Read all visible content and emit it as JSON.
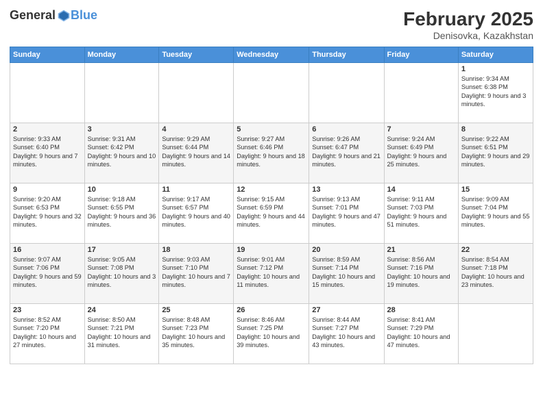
{
  "header": {
    "logo_general": "General",
    "logo_blue": "Blue",
    "title": "February 2025",
    "subtitle": "Denisovka, Kazakhstan"
  },
  "calendar": {
    "days_of_week": [
      "Sunday",
      "Monday",
      "Tuesday",
      "Wednesday",
      "Thursday",
      "Friday",
      "Saturday"
    ],
    "weeks": [
      [
        {
          "day": "",
          "info": ""
        },
        {
          "day": "",
          "info": ""
        },
        {
          "day": "",
          "info": ""
        },
        {
          "day": "",
          "info": ""
        },
        {
          "day": "",
          "info": ""
        },
        {
          "day": "",
          "info": ""
        },
        {
          "day": "1",
          "info": "Sunrise: 9:34 AM\nSunset: 6:38 PM\nDaylight: 9 hours and 3 minutes."
        }
      ],
      [
        {
          "day": "2",
          "info": "Sunrise: 9:33 AM\nSunset: 6:40 PM\nDaylight: 9 hours and 7 minutes."
        },
        {
          "day": "3",
          "info": "Sunrise: 9:31 AM\nSunset: 6:42 PM\nDaylight: 9 hours and 10 minutes."
        },
        {
          "day": "4",
          "info": "Sunrise: 9:29 AM\nSunset: 6:44 PM\nDaylight: 9 hours and 14 minutes."
        },
        {
          "day": "5",
          "info": "Sunrise: 9:27 AM\nSunset: 6:46 PM\nDaylight: 9 hours and 18 minutes."
        },
        {
          "day": "6",
          "info": "Sunrise: 9:26 AM\nSunset: 6:47 PM\nDaylight: 9 hours and 21 minutes."
        },
        {
          "day": "7",
          "info": "Sunrise: 9:24 AM\nSunset: 6:49 PM\nDaylight: 9 hours and 25 minutes."
        },
        {
          "day": "8",
          "info": "Sunrise: 9:22 AM\nSunset: 6:51 PM\nDaylight: 9 hours and 29 minutes."
        }
      ],
      [
        {
          "day": "9",
          "info": "Sunrise: 9:20 AM\nSunset: 6:53 PM\nDaylight: 9 hours and 32 minutes."
        },
        {
          "day": "10",
          "info": "Sunrise: 9:18 AM\nSunset: 6:55 PM\nDaylight: 9 hours and 36 minutes."
        },
        {
          "day": "11",
          "info": "Sunrise: 9:17 AM\nSunset: 6:57 PM\nDaylight: 9 hours and 40 minutes."
        },
        {
          "day": "12",
          "info": "Sunrise: 9:15 AM\nSunset: 6:59 PM\nDaylight: 9 hours and 44 minutes."
        },
        {
          "day": "13",
          "info": "Sunrise: 9:13 AM\nSunset: 7:01 PM\nDaylight: 9 hours and 47 minutes."
        },
        {
          "day": "14",
          "info": "Sunrise: 9:11 AM\nSunset: 7:03 PM\nDaylight: 9 hours and 51 minutes."
        },
        {
          "day": "15",
          "info": "Sunrise: 9:09 AM\nSunset: 7:04 PM\nDaylight: 9 hours and 55 minutes."
        }
      ],
      [
        {
          "day": "16",
          "info": "Sunrise: 9:07 AM\nSunset: 7:06 PM\nDaylight: 9 hours and 59 minutes."
        },
        {
          "day": "17",
          "info": "Sunrise: 9:05 AM\nSunset: 7:08 PM\nDaylight: 10 hours and 3 minutes."
        },
        {
          "day": "18",
          "info": "Sunrise: 9:03 AM\nSunset: 7:10 PM\nDaylight: 10 hours and 7 minutes."
        },
        {
          "day": "19",
          "info": "Sunrise: 9:01 AM\nSunset: 7:12 PM\nDaylight: 10 hours and 11 minutes."
        },
        {
          "day": "20",
          "info": "Sunrise: 8:59 AM\nSunset: 7:14 PM\nDaylight: 10 hours and 15 minutes."
        },
        {
          "day": "21",
          "info": "Sunrise: 8:56 AM\nSunset: 7:16 PM\nDaylight: 10 hours and 19 minutes."
        },
        {
          "day": "22",
          "info": "Sunrise: 8:54 AM\nSunset: 7:18 PM\nDaylight: 10 hours and 23 minutes."
        }
      ],
      [
        {
          "day": "23",
          "info": "Sunrise: 8:52 AM\nSunset: 7:20 PM\nDaylight: 10 hours and 27 minutes."
        },
        {
          "day": "24",
          "info": "Sunrise: 8:50 AM\nSunset: 7:21 PM\nDaylight: 10 hours and 31 minutes."
        },
        {
          "day": "25",
          "info": "Sunrise: 8:48 AM\nSunset: 7:23 PM\nDaylight: 10 hours and 35 minutes."
        },
        {
          "day": "26",
          "info": "Sunrise: 8:46 AM\nSunset: 7:25 PM\nDaylight: 10 hours and 39 minutes."
        },
        {
          "day": "27",
          "info": "Sunrise: 8:44 AM\nSunset: 7:27 PM\nDaylight: 10 hours and 43 minutes."
        },
        {
          "day": "28",
          "info": "Sunrise: 8:41 AM\nSunset: 7:29 PM\nDaylight: 10 hours and 47 minutes."
        },
        {
          "day": "",
          "info": ""
        }
      ]
    ]
  }
}
